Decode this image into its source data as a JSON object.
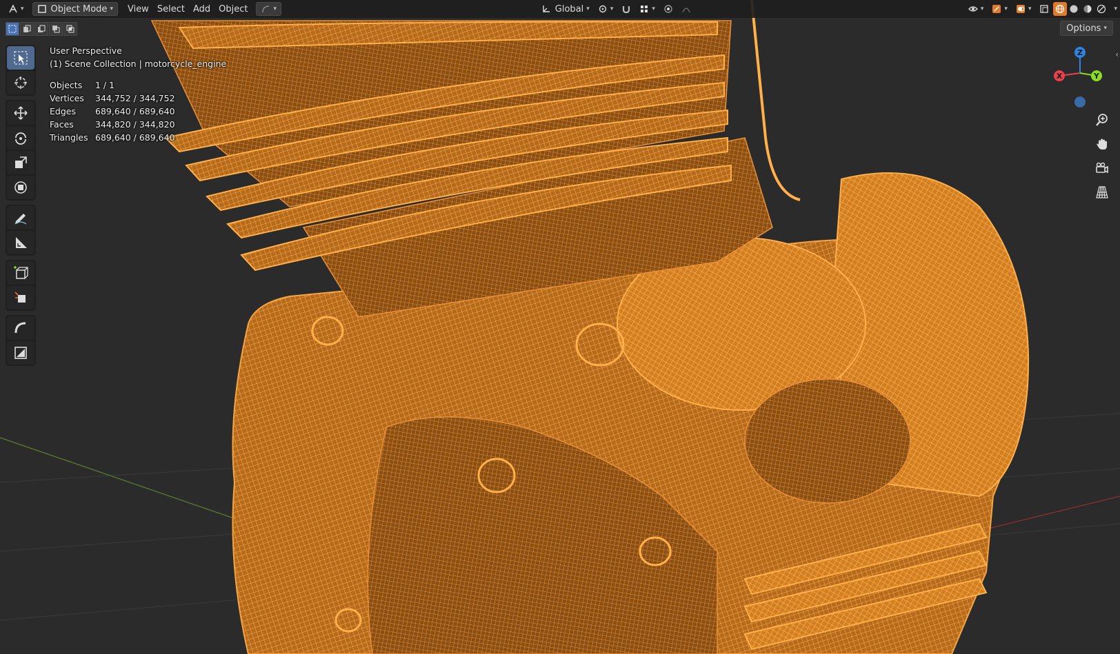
{
  "header": {
    "mode": "Object Mode",
    "menus": [
      "View",
      "Select",
      "Add",
      "Object"
    ],
    "transform_orientation": "Global",
    "options_label": "Options"
  },
  "viewport": {
    "perspective": "User Perspective",
    "collection": "(1) Scene Collection | motorcycle_engine",
    "stats": [
      {
        "label": "Objects",
        "value": "1 / 1"
      },
      {
        "label": "Vertices",
        "value": "344,752 / 344,752"
      },
      {
        "label": "Edges",
        "value": "689,640 / 689,640"
      },
      {
        "label": "Faces",
        "value": "344,820 / 344,820"
      },
      {
        "label": "Triangles",
        "value": "689,640 / 689,640"
      }
    ]
  },
  "gizmo": {
    "x": "X",
    "y": "Y",
    "z": "Z"
  },
  "toolbar": {
    "tools": [
      "select-box",
      "cursor",
      "move",
      "rotate",
      "scale",
      "transform",
      "annotate",
      "measure",
      "add-cube",
      "add-object",
      "curve",
      "image"
    ]
  },
  "colors": {
    "wire": "#f0922c",
    "background": "#2b2b2b",
    "axis_x": "#e8424f",
    "axis_y": "#8bdc22",
    "axis_z": "#2f83e3"
  }
}
